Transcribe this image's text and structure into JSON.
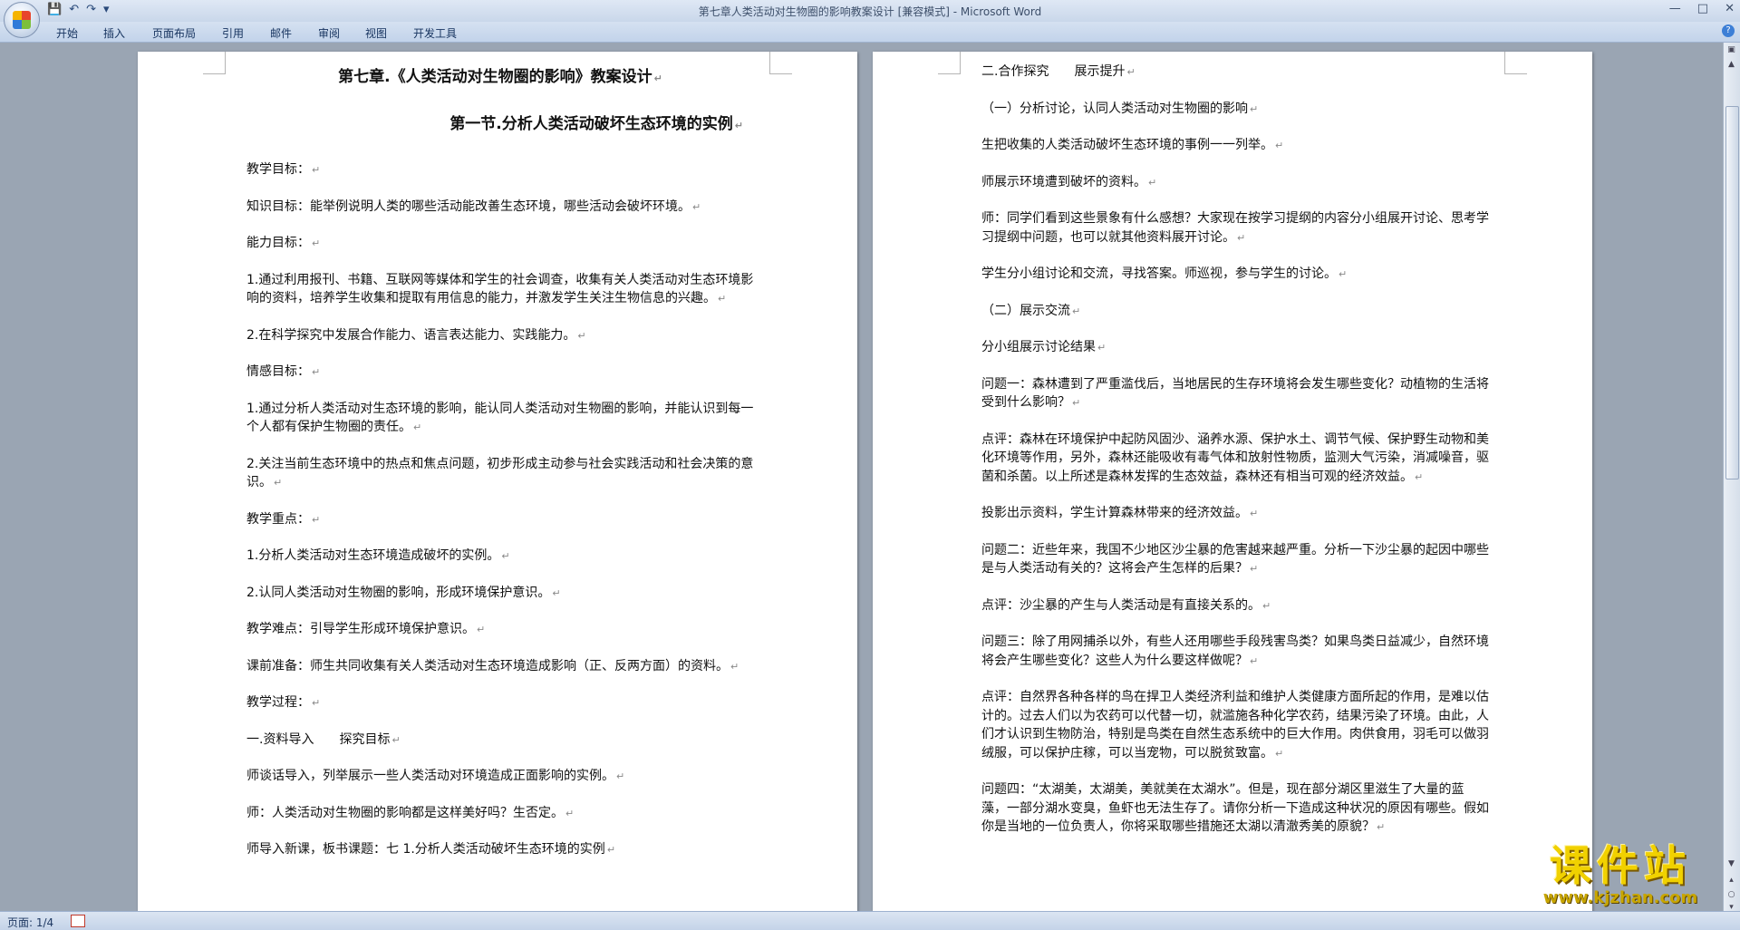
{
  "window": {
    "title": "第七章人类活动对生物圈的影响教案设计 [兼容模式] - Microsoft Word",
    "controls": [
      "—",
      "□",
      "✕"
    ]
  },
  "qat": {
    "save_icon": "save-icon",
    "undo_icon": "undo-icon",
    "redo_icon": "redo-icon"
  },
  "tabs": [
    "开始",
    "插入",
    "页面布局",
    "引用",
    "邮件",
    "审阅",
    "视图",
    "开发工具"
  ],
  "left_page": {
    "title": "第七章.《人类活动对生物圈的影响》教案设计",
    "subtitle": "第一节.分析人类活动破坏生态环境的实例",
    "paragraphs": [
      "教学目标：",
      "知识目标：能举例说明人类的哪些活动能改善生态环境，哪些活动会破坏环境。",
      "能力目标：",
      "1.通过利用报刊、书籍、互联网等媒体和学生的社会调查，收集有关人类活动对生态环境影响的资料，培养学生收集和提取有用信息的能力，并激发学生关注生物信息的兴趣。",
      "2.在科学探究中发展合作能力、语言表达能力、实践能力。",
      "情感目标：",
      "1.通过分析人类活动对生态环境的影响，能认同人类活动对生物圈的影响，并能认识到每一个人都有保护生物圈的责任。",
      "2.关注当前生态环境中的热点和焦点问题，初步形成主动参与社会实践活动和社会决策的意识。",
      "教学重点：",
      "1.分析人类活动对生态环境造成破坏的实例。",
      "2.认同人类活动对生物圈的影响，形成环境保护意识。",
      "教学难点：引导学生形成环境保护意识。",
      "课前准备：师生共同收集有关人类活动对生态环境造成影响（正、反两方面）的资料。",
      "教学过程：",
      "一.资料导入　　探究目标",
      "师谈话导入，列举展示一些人类活动对环境造成正面影响的实例。",
      "师：人类活动对生物圈的影响都是这样美好吗？生否定。",
      "师导入新课，板书课题：七 1.分析人类活动破坏生态环境的实例"
    ]
  },
  "right_page": {
    "paragraphs": [
      "二.合作探究　　展示提升",
      "（一）分析讨论，认同人类活动对生物圈的影响",
      "生把收集的人类活动破坏生态环境的事例一一列举。",
      "师展示环境遭到破坏的资料。",
      "师：同学们看到这些景象有什么感想？大家现在按学习提纲的内容分小组展开讨论、思考学习提纲中问题，也可以就其他资料展开讨论。",
      "学生分小组讨论和交流，寻找答案。师巡视，参与学生的讨论。",
      "（二）展示交流",
      "分小组展示讨论结果",
      "问题一：森林遭到了严重滥伐后，当地居民的生存环境将会发生哪些变化？动植物的生活将受到什么影响？",
      "点评：森林在环境保护中起防风固沙、涵养水源、保护水土、调节气候、保护野生动物和美化环境等作用，另外，森林还能吸收有毒气体和放射性物质，监测大气污染，消减噪音，驱菌和杀菌。以上所述是森林发挥的生态效益，森林还有相当可观的经济效益。",
      "投影出示资料，学生计算森林带来的经济效益。",
      "问题二：近些年来，我国不少地区沙尘暴的危害越来越严重。分析一下沙尘暴的起因中哪些是与人类活动有关的？这将会产生怎样的后果？",
      "点评：沙尘暴的产生与人类活动是有直接关系的。",
      "问题三：除了用网捕杀以外，有些人还用哪些手段残害鸟类？如果鸟类日益减少，自然环境将会产生哪些变化？这些人为什么要这样做呢？",
      "点评：自然界各种各样的鸟在捍卫人类经济利益和维护人类健康方面所起的作用，是难以估计的。过去人们以为农药可以代替一切，就滥施各种化学农药，结果污染了环境。由此，人们才认识到生物防治，特别是鸟类在自然生态系统中的巨大作用。肉供食用，羽毛可以做羽绒服，可以保护庄稼，可以当宠物，可以脱贫致富。",
      "问题四：“太湖美，太湖美，美就美在太湖水”。但是，现在部分湖区里滋生了大量的蓝藻，一部分湖水变臭，鱼虾也无法生存了。请你分析一下造成这种状况的原因有哪些。假如你是当地的一位负责人，你将采取哪些措施还太湖以清澈秀美的原貌？"
    ]
  },
  "paragraph_mark": "↵",
  "status": {
    "page": "页面: 1/4"
  },
  "watermark": {
    "title": "课件站",
    "url": "www.kjzhan.com"
  }
}
